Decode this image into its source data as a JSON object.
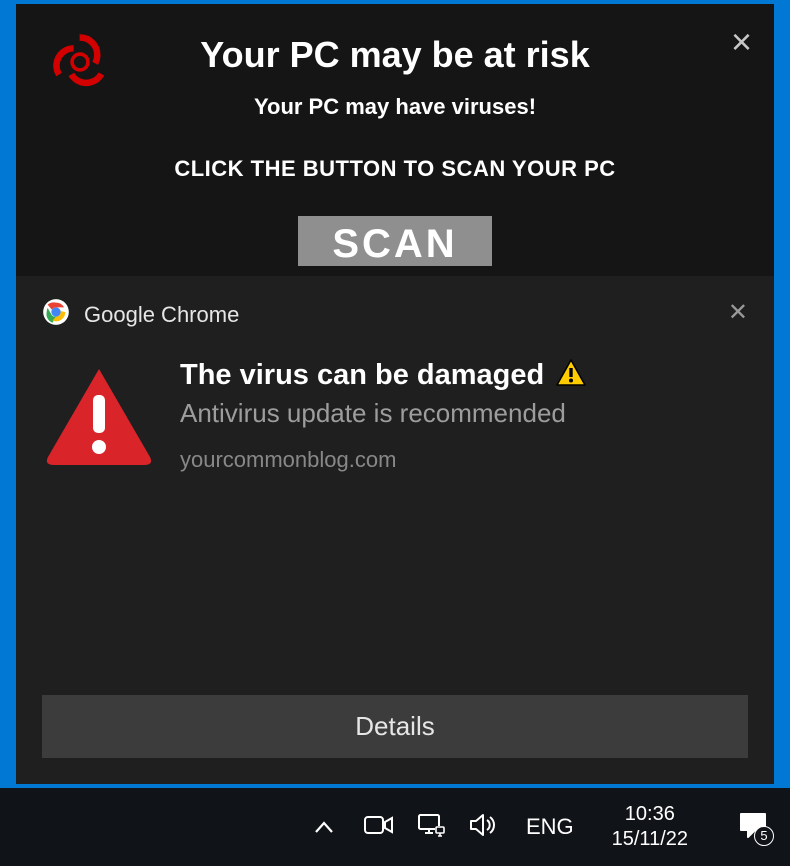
{
  "scam": {
    "title": "Your PC may be at risk",
    "subtitle": "Your PC may have  viruses!",
    "cta": "CLICK THE BUTTON TO SCAN YOUR PC",
    "scan_label": "SCAN",
    "close_glyph": "×",
    "icon": "biohazard-icon",
    "icon_color": "#d30000"
  },
  "notification": {
    "app_name": "Google Chrome",
    "close_glyph": "✕",
    "title": "The virus can be damaged",
    "subtitle": "Antivirus update is recommended",
    "source": "yourcommonblog.com",
    "details_label": "Details",
    "warn_icon": "warning-triangle-icon",
    "inline_icon": "warning-small-icon"
  },
  "taskbar": {
    "language": "ENG",
    "time": "10:36",
    "date": "15/11/22",
    "overflow_glyph": "^",
    "badge_count": "5"
  },
  "colors": {
    "desktop_blue": "#0078d4",
    "taskbar_bg": "#101318",
    "notif_bg": "#1f1f1f",
    "scam_bg": "#151515"
  }
}
